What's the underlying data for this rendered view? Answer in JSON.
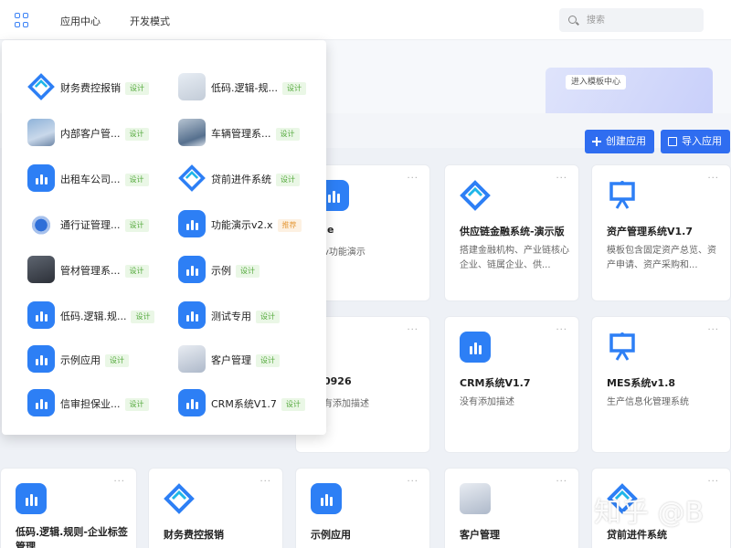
{
  "topbar": {
    "nav": [
      "应用中心",
      "开发模式"
    ],
    "search_placeholder": "搜索"
  },
  "banner": {
    "enter_label": "进入模板中心"
  },
  "actions": {
    "create": "创建应用",
    "import": "导入应用"
  },
  "dropdown": {
    "items": [
      {
        "label": "财务费控报销",
        "badge": "设计",
        "icon": "diamond-logo-icon"
      },
      {
        "label": "低码.逻辑-规...",
        "badge": "设计",
        "icon": "sketch-thumbnail-icon"
      },
      {
        "label": "内部客户管...",
        "badge": "设计",
        "icon": "office-photo-icon"
      },
      {
        "label": "车辆管理系...",
        "badge": "设计",
        "icon": "car-photo-icon"
      },
      {
        "label": "出租车公司...",
        "badge": "设计",
        "icon": "bar-chart-app-icon"
      },
      {
        "label": "贷前进件系统",
        "badge": "设计",
        "icon": "diamond-logo-icon"
      },
      {
        "label": "通行证管理...",
        "badge": "设计",
        "icon": "globe-network-icon"
      },
      {
        "label": "功能演示v2.x",
        "badge": "推荐",
        "icon": "bar-chart-app-icon"
      },
      {
        "label": "管材管理系...",
        "badge": "设计",
        "icon": "dark-device-icon"
      },
      {
        "label": "示例",
        "badge": "设计",
        "icon": "bar-chart-app-icon"
      },
      {
        "label": "低码.逻辑.规...",
        "badge": "设计",
        "icon": "bar-chart-app-icon"
      },
      {
        "label": "测试专用",
        "badge": "设计",
        "icon": "bar-chart-app-icon"
      },
      {
        "label": "示例应用",
        "badge": "设计",
        "icon": "bar-chart-app-icon"
      },
      {
        "label": "客户管理",
        "badge": "设计",
        "icon": "cube-3d-icon"
      },
      {
        "label": "信审担保业...",
        "badge": "设计",
        "icon": "bar-chart-app-icon"
      },
      {
        "label": "CRM系统V1.7",
        "badge": "设计",
        "icon": "bar-chart-app-icon"
      }
    ]
  },
  "cards": {
    "row1": [
      {
        "title": "供应链金融系统-演示版",
        "desc": "搭建金融机构、产业链核心企业、链属企业、供...",
        "icon": "diamond-logo-icon"
      },
      {
        "title": "资产管理系统V1.7",
        "desc": "模板包含固定资产总览、资产申请、资产采购和...",
        "icon": "presentation-board-icon"
      }
    ],
    "row1_fragment": {
      "title": "e",
      "desc": "v功能演示"
    },
    "row2": [
      {
        "title": "CRM系统V1.7",
        "desc": "没有添加描述",
        "icon": "bar-chart-app-icon"
      },
      {
        "title": "MES系统v1.8",
        "desc": "生产信息化管理系统",
        "icon": "presentation-board-icon"
      }
    ],
    "row2_fragment": {
      "title": "0926",
      "desc": "有添加描述"
    },
    "row3": [
      {
        "title": "低码.逻辑.规则-企业标签管理",
        "icon": "bar-chart-app-icon"
      },
      {
        "title": "财务费控报销",
        "icon": "diamond-logo-icon"
      },
      {
        "title": "示例应用",
        "icon": "bar-chart-app-icon"
      },
      {
        "title": "客户管理",
        "icon": "cube-3d-icon"
      },
      {
        "title": "贷前进件系统",
        "icon": "diamond-logo-icon"
      }
    ]
  },
  "watermark": "知乎 @B",
  "colors": {
    "primary": "#2f6df0",
    "app_icon": "#2d7ff5",
    "badge_design": "#52a83a",
    "badge_recommend": "#e59a3b"
  }
}
